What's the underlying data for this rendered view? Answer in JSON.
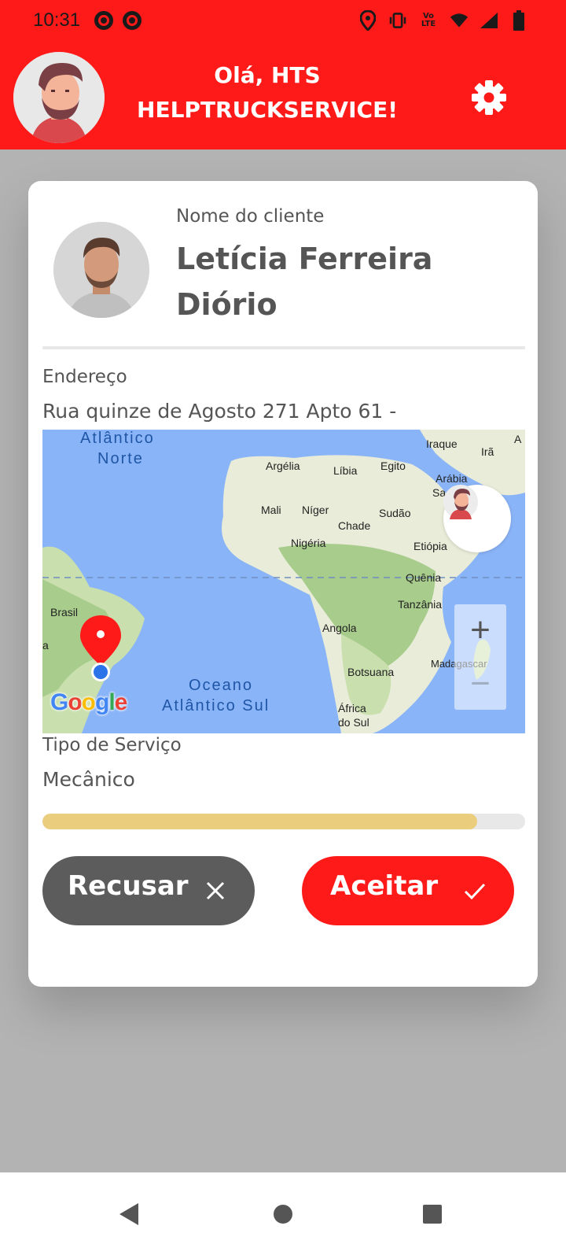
{
  "status_bar": {
    "time": "10:31",
    "left_icons": [
      "chrome-icon",
      "chrome-icon"
    ],
    "right_icons": [
      "location-icon",
      "vibrate-icon",
      "volte-icon",
      "wifi-icon",
      "signal-icon",
      "battery-icon"
    ],
    "volte_text": "Vo LTE"
  },
  "header": {
    "greeting_line1": "Olá, HTS",
    "greeting_line2": "HELPTRUCKSERVICE!",
    "background_color": "#ff1a1a"
  },
  "client": {
    "label": "Nome do cliente",
    "name": "Letícia Ferreira Diório"
  },
  "address": {
    "label": "Endereço",
    "value": "Rua quinze de Agosto  271 Apto 61 -"
  },
  "map": {
    "labels": {
      "atlantico_norte_1": "Atlântico",
      "atlantico_norte_2": "Norte",
      "iraque": "Iraque",
      "ira": "Irã",
      "a": "A",
      "argelia": "Argélia",
      "libia": "Líbia",
      "egito": "Egito",
      "arabia": "Arábia",
      "sa": "Sa",
      "mali": "Mali",
      "niger": "Níger",
      "sudao": "Sudão",
      "chade": "Chade",
      "nigeria": "Nigéria",
      "etiopia": "Etiópia",
      "quenia": "Quênia",
      "tanzania": "Tanzânia",
      "brasil": "Brasil",
      "angola": "Angola",
      "madagascar": "Madagascar",
      "botsuana": "Botsuana",
      "oceano": "Oceano",
      "atlantico_sul": "Atlântico Sul",
      "africa": "África",
      "do_sul": "do Sul",
      "side_a": "a"
    },
    "google": [
      "G",
      "o",
      "o",
      "g",
      "l",
      "e"
    ],
    "zoom_in": "+",
    "zoom_out": "−"
  },
  "service": {
    "label": "Tipo de Serviço",
    "value": "Mecânico"
  },
  "progress": {
    "fraction": 0.9,
    "color": "#ebcd7e"
  },
  "actions": {
    "refuse_label": "Recusar",
    "accept_label": "Aceitar",
    "refuse_color": "#5c5c5c",
    "accept_color": "#ff1a1a"
  },
  "nav": [
    "back-icon",
    "home-icon",
    "recents-icon"
  ]
}
